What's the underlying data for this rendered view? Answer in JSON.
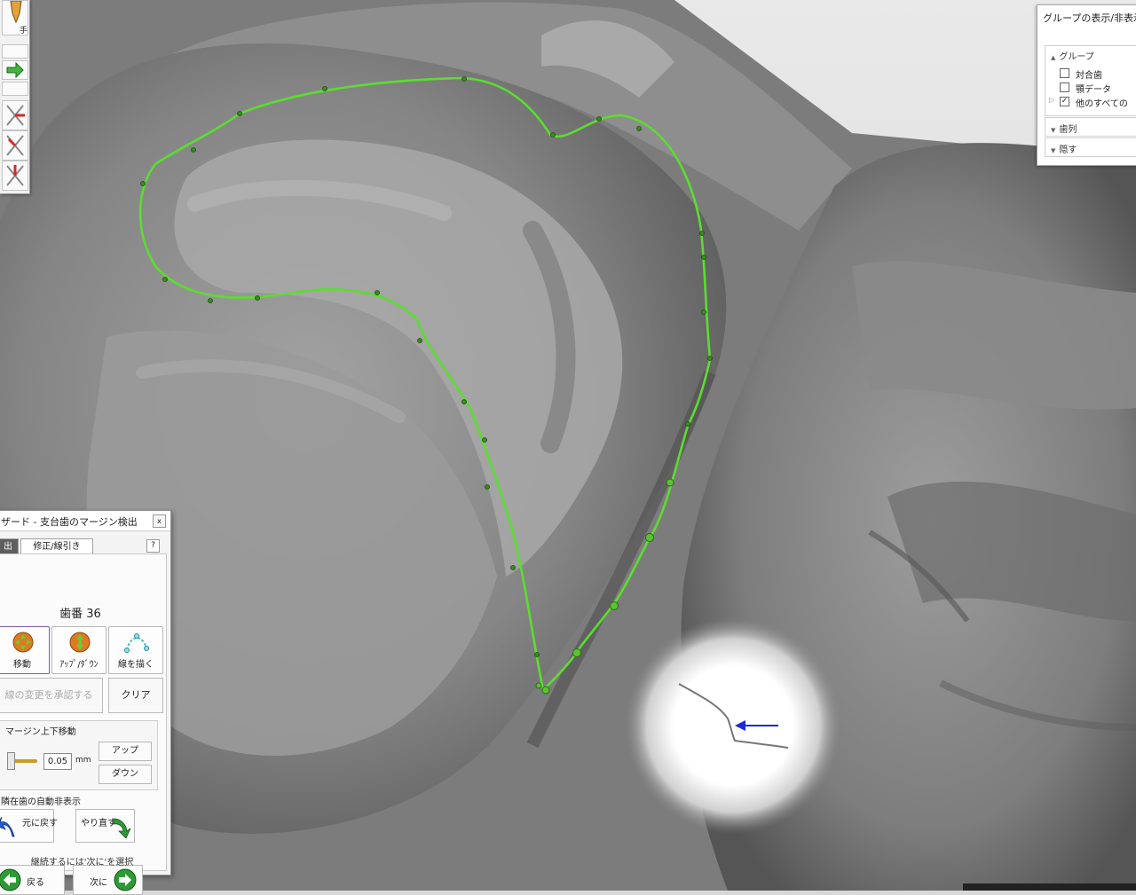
{
  "group_panel": {
    "title": "グループの表示/非表示",
    "section_group": "グループ",
    "items": [
      {
        "label": "対合歯",
        "checked": false
      },
      {
        "label": "顎データ",
        "checked": false
      },
      {
        "label": "他のすべての",
        "checked": true
      }
    ],
    "section_arch": "歯列",
    "section_hide": "隠す"
  },
  "toolbar": {
    "partial_label": "手"
  },
  "wizard": {
    "title": "ザード - 支台歯のマージン検出",
    "close_glyph": "x",
    "tab_detect": "出",
    "tab_edit": "修正/線引き",
    "help_glyph": "?",
    "tooth_number": "歯番 36",
    "btn_move": "移動",
    "btn_updown": "ｱｯﾌﾟ/ﾀﾞｳﾝ",
    "btn_draw": "線を描く",
    "btn_accept": "線の変更を承認する",
    "btn_clear": "クリア",
    "section_updown": "マージン上下移動",
    "step_value": "0.05",
    "unit": "mm",
    "btn_up": "アップ",
    "btn_down": "ダウン",
    "section_autohide": "隣在歯の自動非表示",
    "btn_undo": "元に戻す",
    "btn_redo": "やり直す",
    "btn_back": "戻る",
    "btn_next": "次に",
    "footer": "継続するには'次に'を選択"
  },
  "colors": {
    "margin_line": "#5bde2f",
    "model": "#7a7a7a",
    "arrow": "#1a2ad8",
    "nav_green": "#2e9a35",
    "undo_blue": "#1f5fd6"
  }
}
